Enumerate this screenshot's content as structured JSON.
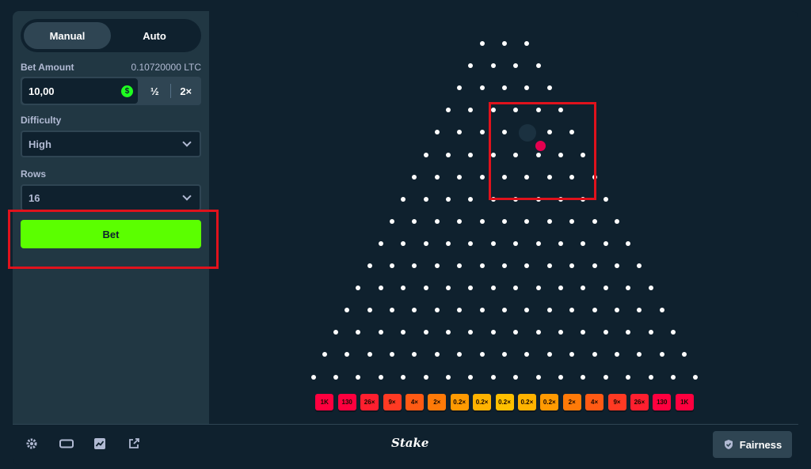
{
  "modes": {
    "manual": "Manual",
    "auto": "Auto"
  },
  "bet_amount": {
    "label": "Bet Amount",
    "balance": "0.10720000 LTC",
    "value": "10,00",
    "coin_symbol": "$",
    "half_label": "½",
    "double_label": "2×"
  },
  "difficulty": {
    "label": "Difficulty",
    "value": "High"
  },
  "rows": {
    "label": "Rows",
    "value": "16"
  },
  "bet_button": "Bet",
  "multipliers": [
    "1K",
    "130",
    "26×",
    "9×",
    "4×",
    "2×",
    "0.2×",
    "0.2×",
    "0.2×",
    "0.2×",
    "0.2×",
    "2×",
    "4×",
    "9×",
    "26×",
    "130",
    "1K"
  ],
  "bucket_colors": [
    "#ff003f",
    "#ff003f",
    "#ff1f2f",
    "#ff3a23",
    "#ff5a14",
    "#ff7a08",
    "#ff9a02",
    "#ffb300",
    "#ffc000",
    "#ffb300",
    "#ff9a02",
    "#ff7a08",
    "#ff5a14",
    "#ff3a23",
    "#ff1f2f",
    "#ff003f",
    "#ff003f"
  ],
  "brand": {
    "logo_text": "Stake",
    "accent": "#5bff00",
    "ball_color": "#e3004f"
  },
  "footer": {
    "icons": [
      "gear-icon",
      "theatre-mode-icon",
      "stats-icon",
      "popout-icon"
    ],
    "fairness_label": "Fairness"
  }
}
